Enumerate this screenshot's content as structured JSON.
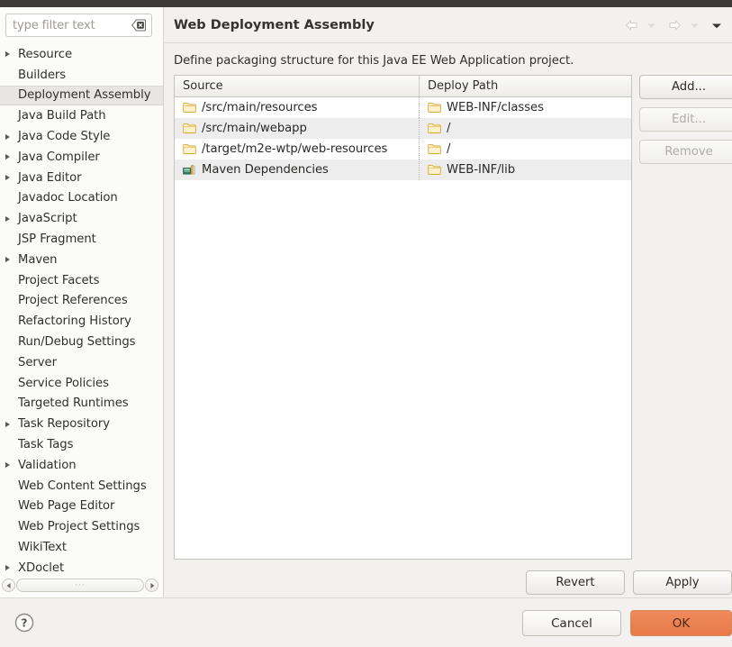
{
  "window": {
    "titlebar_color": "#3c3b37"
  },
  "sidebar": {
    "filter": {
      "placeholder": "type filter text",
      "value": "",
      "clear_icon": "clear-x-icon"
    },
    "items": [
      {
        "label": "Resource",
        "expandable": true,
        "selected": false
      },
      {
        "label": "Builders",
        "expandable": false,
        "selected": false
      },
      {
        "label": "Deployment Assembly",
        "expandable": false,
        "selected": true
      },
      {
        "label": "Java Build Path",
        "expandable": false,
        "selected": false
      },
      {
        "label": "Java Code Style",
        "expandable": true,
        "selected": false
      },
      {
        "label": "Java Compiler",
        "expandable": true,
        "selected": false
      },
      {
        "label": "Java Editor",
        "expandable": true,
        "selected": false
      },
      {
        "label": "Javadoc Location",
        "expandable": false,
        "selected": false
      },
      {
        "label": "JavaScript",
        "expandable": true,
        "selected": false
      },
      {
        "label": "JSP Fragment",
        "expandable": false,
        "selected": false
      },
      {
        "label": "Maven",
        "expandable": true,
        "selected": false
      },
      {
        "label": "Project Facets",
        "expandable": false,
        "selected": false
      },
      {
        "label": "Project References",
        "expandable": false,
        "selected": false
      },
      {
        "label": "Refactoring History",
        "expandable": false,
        "selected": false
      },
      {
        "label": "Run/Debug Settings",
        "expandable": false,
        "selected": false
      },
      {
        "label": "Server",
        "expandable": false,
        "selected": false
      },
      {
        "label": "Service Policies",
        "expandable": false,
        "selected": false
      },
      {
        "label": "Targeted Runtimes",
        "expandable": false,
        "selected": false
      },
      {
        "label": "Task Repository",
        "expandable": true,
        "selected": false
      },
      {
        "label": "Task Tags",
        "expandable": false,
        "selected": false
      },
      {
        "label": "Validation",
        "expandable": true,
        "selected": false
      },
      {
        "label": "Web Content Settings",
        "expandable": false,
        "selected": false
      },
      {
        "label": "Web Page Editor",
        "expandable": false,
        "selected": false
      },
      {
        "label": "Web Project Settings",
        "expandable": false,
        "selected": false
      },
      {
        "label": "WikiText",
        "expandable": false,
        "selected": false
      },
      {
        "label": "XDoclet",
        "expandable": true,
        "selected": false
      }
    ],
    "scrollbar": {
      "left_arrow_icon": "arrow-left-icon",
      "right_arrow_icon": "arrow-right-icon",
      "grip": "···"
    }
  },
  "page": {
    "title": "Web Deployment Assembly",
    "description": "Define packaging structure for this Java EE Web Application project.",
    "nav": [
      {
        "name": "back-arrow-icon",
        "enabled": false
      },
      {
        "name": "back-dropdown-icon",
        "enabled": false
      },
      {
        "name": "forward-arrow-icon",
        "enabled": false
      },
      {
        "name": "forward-dropdown-icon",
        "enabled": false
      },
      {
        "name": "menu-dropdown-icon",
        "enabled": true
      }
    ]
  },
  "table": {
    "columns": [
      "Source",
      "Deploy Path"
    ],
    "rows": [
      {
        "source": "/src/main/resources",
        "source_icon": "folder-icon",
        "deploy": "WEB-INF/classes",
        "deploy_icon": "folder-icon"
      },
      {
        "source": "/src/main/webapp",
        "source_icon": "folder-icon",
        "deploy": "/",
        "deploy_icon": "folder-icon"
      },
      {
        "source": "/target/m2e-wtp/web-resources",
        "source_icon": "folder-icon",
        "deploy": "/",
        "deploy_icon": "folder-icon"
      },
      {
        "source": "Maven Dependencies",
        "source_icon": "library-icon",
        "deploy": "WEB-INF/lib",
        "deploy_icon": "folder-icon"
      }
    ]
  },
  "side_buttons": [
    {
      "label": "Add...",
      "enabled": true
    },
    {
      "label": "Edit...",
      "enabled": false
    },
    {
      "label": "Remove",
      "enabled": false
    }
  ],
  "bottom_actions": [
    {
      "label": "Revert",
      "enabled": true
    },
    {
      "label": "Apply",
      "enabled": true
    }
  ],
  "footer": {
    "help_icon": "help-question-icon",
    "cancel_label": "Cancel",
    "ok_label": "OK",
    "ok_color": "#f08a5d"
  }
}
